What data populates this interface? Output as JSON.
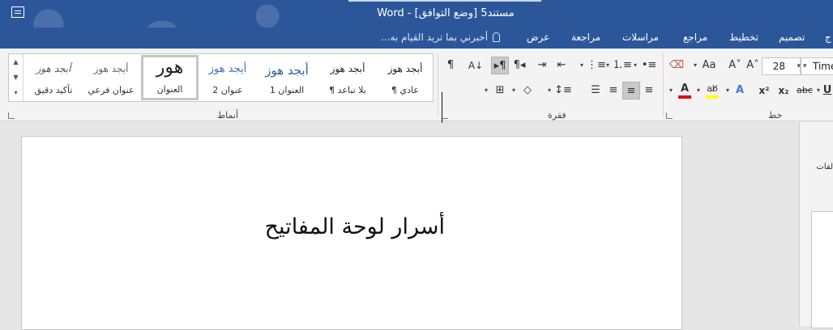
{
  "window": {
    "title": "مستند5 [وضع التوافق] - Word"
  },
  "tabs": [
    {
      "label": "ج"
    },
    {
      "label": "تصميم"
    },
    {
      "label": "تخطيط"
    },
    {
      "label": "مراجع"
    },
    {
      "label": "مراسلات"
    },
    {
      "label": "مراجعة"
    },
    {
      "label": "عرض"
    }
  ],
  "tell_me": {
    "placeholder": "أخبرني بما تريد القيام به..."
  },
  "ribbon": {
    "groups": {
      "styles_label": "أنماط",
      "paragraph_label": "فقرة",
      "font_label": "خط"
    },
    "styles": [
      {
        "preview": "أبجد هوز",
        "name": "¶ عادي"
      },
      {
        "preview": "أبجد هوز",
        "name": "¶ بلا تباعد"
      },
      {
        "preview": "أبجد هوز",
        "name": "العنوان 1"
      },
      {
        "preview": "أيجد هوز",
        "name": "عنوان 2"
      },
      {
        "preview": "هور",
        "name": "العنوان"
      },
      {
        "preview": "أيجد هوز",
        "name": "عنوان فرعي"
      },
      {
        "preview": "أبجد هوز",
        "name": "تأكيد دقيق"
      }
    ],
    "font": {
      "size": "28",
      "name": "Time"
    },
    "colors": {
      "font_color": "#e00000",
      "highlight": "#ffff00",
      "text_effect": "#3b7bd4"
    }
  },
  "document": {
    "text": "أسرار لوحة المفاتيح"
  },
  "side_pane": {
    "label": "لفات"
  }
}
